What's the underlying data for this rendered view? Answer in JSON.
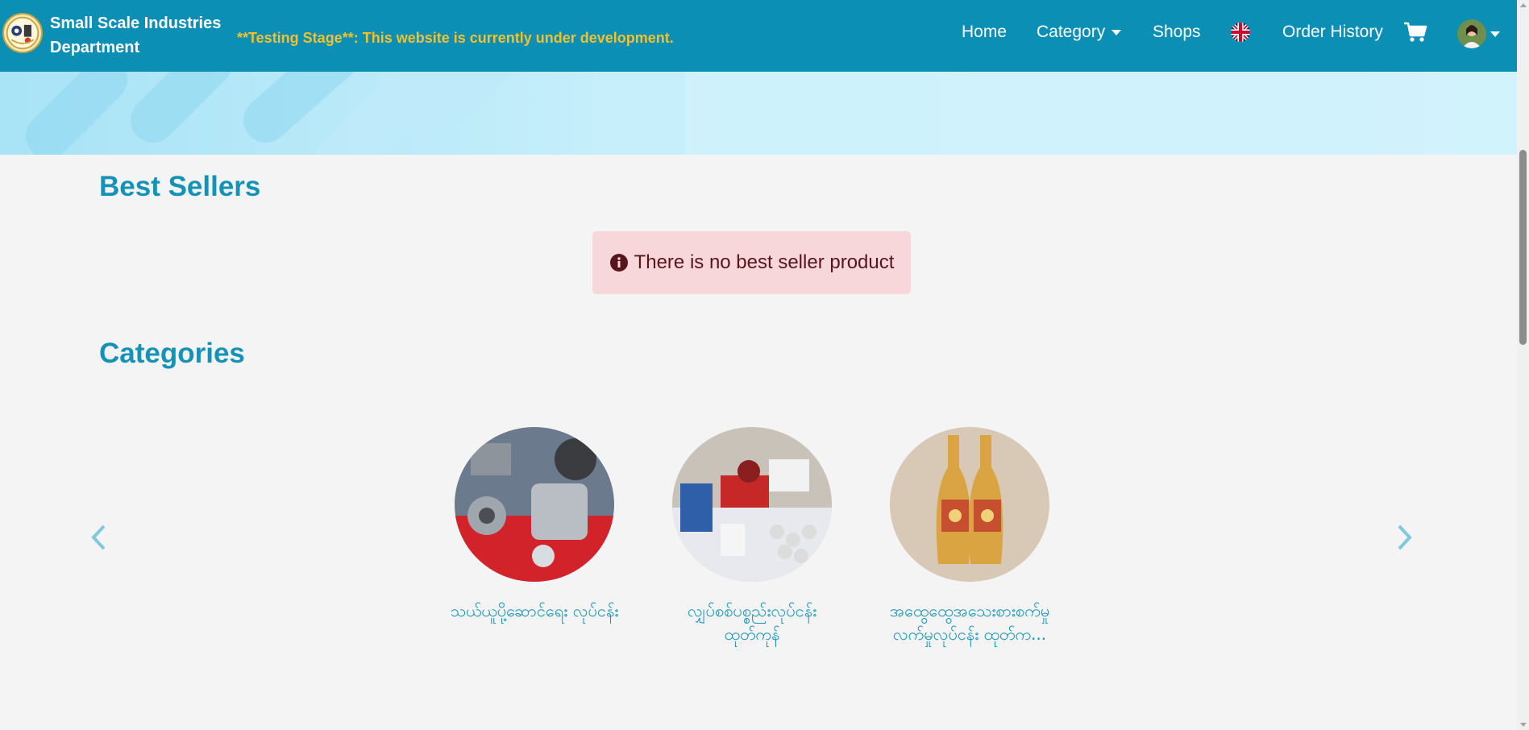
{
  "header": {
    "brand_line1": "Small Scale Industries",
    "brand_line2": "Department",
    "notice": "**Testing Stage**: This website is currently under development.",
    "nav": {
      "home": "Home",
      "category": "Category",
      "shops": "Shops",
      "order_history": "Order History"
    },
    "icons": {
      "logo": "department-logo-icon",
      "language": "uk-flag-icon",
      "cart": "cart-icon",
      "user": "user-avatar"
    }
  },
  "best_sellers": {
    "title": "Best Sellers",
    "alert_icon": "info-circle-icon",
    "alert_text": "There is no best seller product"
  },
  "categories": {
    "title": "Categories",
    "items": [
      {
        "label": "သယ်ယူပို့ဆောင်ရေး လုပ်ငန်း"
      },
      {
        "label": "လျှပ်စစ်ပစ္စည်းလုပ်ငန်း ထုတ်ကုန်"
      },
      {
        "label": "အထွေထွေအသေးစားစက်မှု လက်မှုလုပ်ငန်း ထုတ်က..."
      }
    ],
    "prev_icon": "chevron-left-icon",
    "next_icon": "chevron-right-icon"
  },
  "colors": {
    "navbar": "#0c8fb5",
    "notice": "#f2c12e",
    "accent": "#1592b6",
    "alert_bg": "#f8d7da",
    "alert_text": "#58151c"
  }
}
